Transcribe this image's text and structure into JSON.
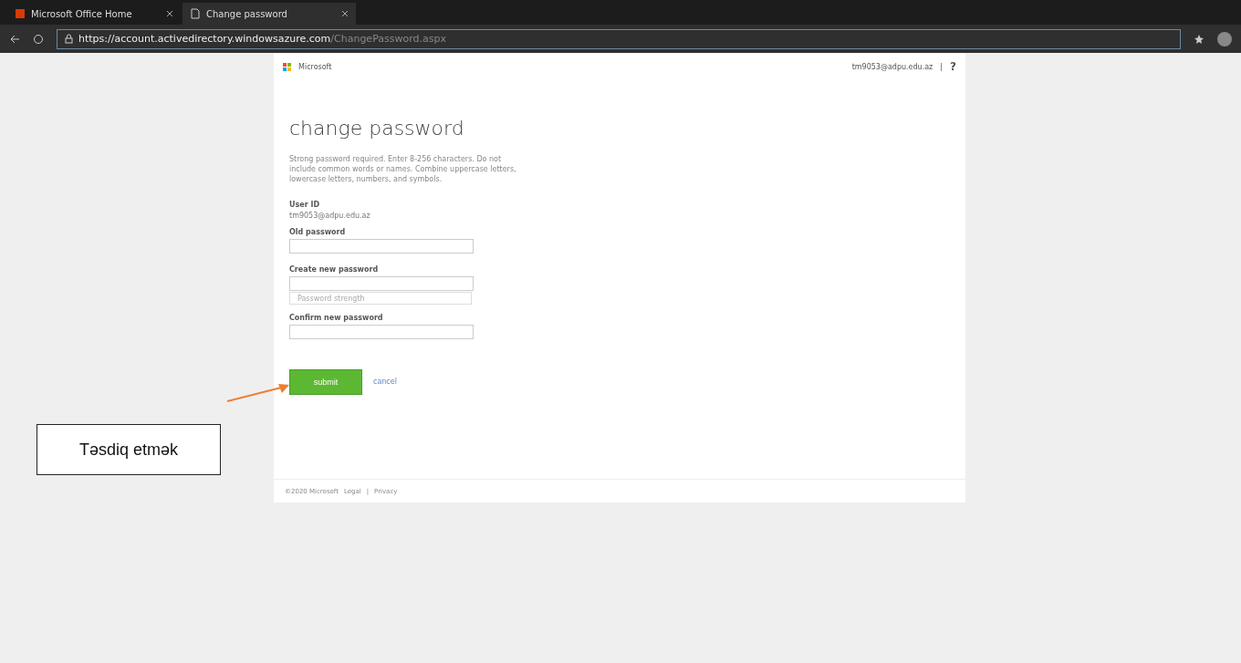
{
  "browser": {
    "tabs": [
      {
        "title": "Microsoft Office Home",
        "selected": false
      },
      {
        "title": "Change password",
        "selected": true
      }
    ],
    "url_host": "https://account.activedirectory.windowsazure.com",
    "url_path": "/ChangePassword.aspx"
  },
  "header": {
    "brand": "Microsoft",
    "account": "tm9053@adpu.edu.az",
    "separator": "|",
    "help": "?"
  },
  "form": {
    "title": "change password",
    "description": "Strong password required. Enter 8-256 characters. Do not include common words or names. Combine uppercase letters, lowercase letters, numbers, and symbols.",
    "user_id_label": "User ID",
    "user_id": "tm9053@adpu.edu.az",
    "fields": [
      {
        "kind": "input",
        "label": "Old password"
      },
      {
        "kind": "input",
        "label": "Create new password"
      },
      {
        "kind": "strength",
        "placeholder": "Password strength"
      },
      {
        "kind": "input",
        "label": "Confirm new password"
      }
    ],
    "submit": "submit",
    "cancel": "cancel"
  },
  "footer": {
    "copyright": "©2020 Microsoft",
    "legal": "Legal",
    "separator": "|",
    "privacy": "Privacy"
  },
  "callout": {
    "text": "Təsdiq etmək"
  }
}
